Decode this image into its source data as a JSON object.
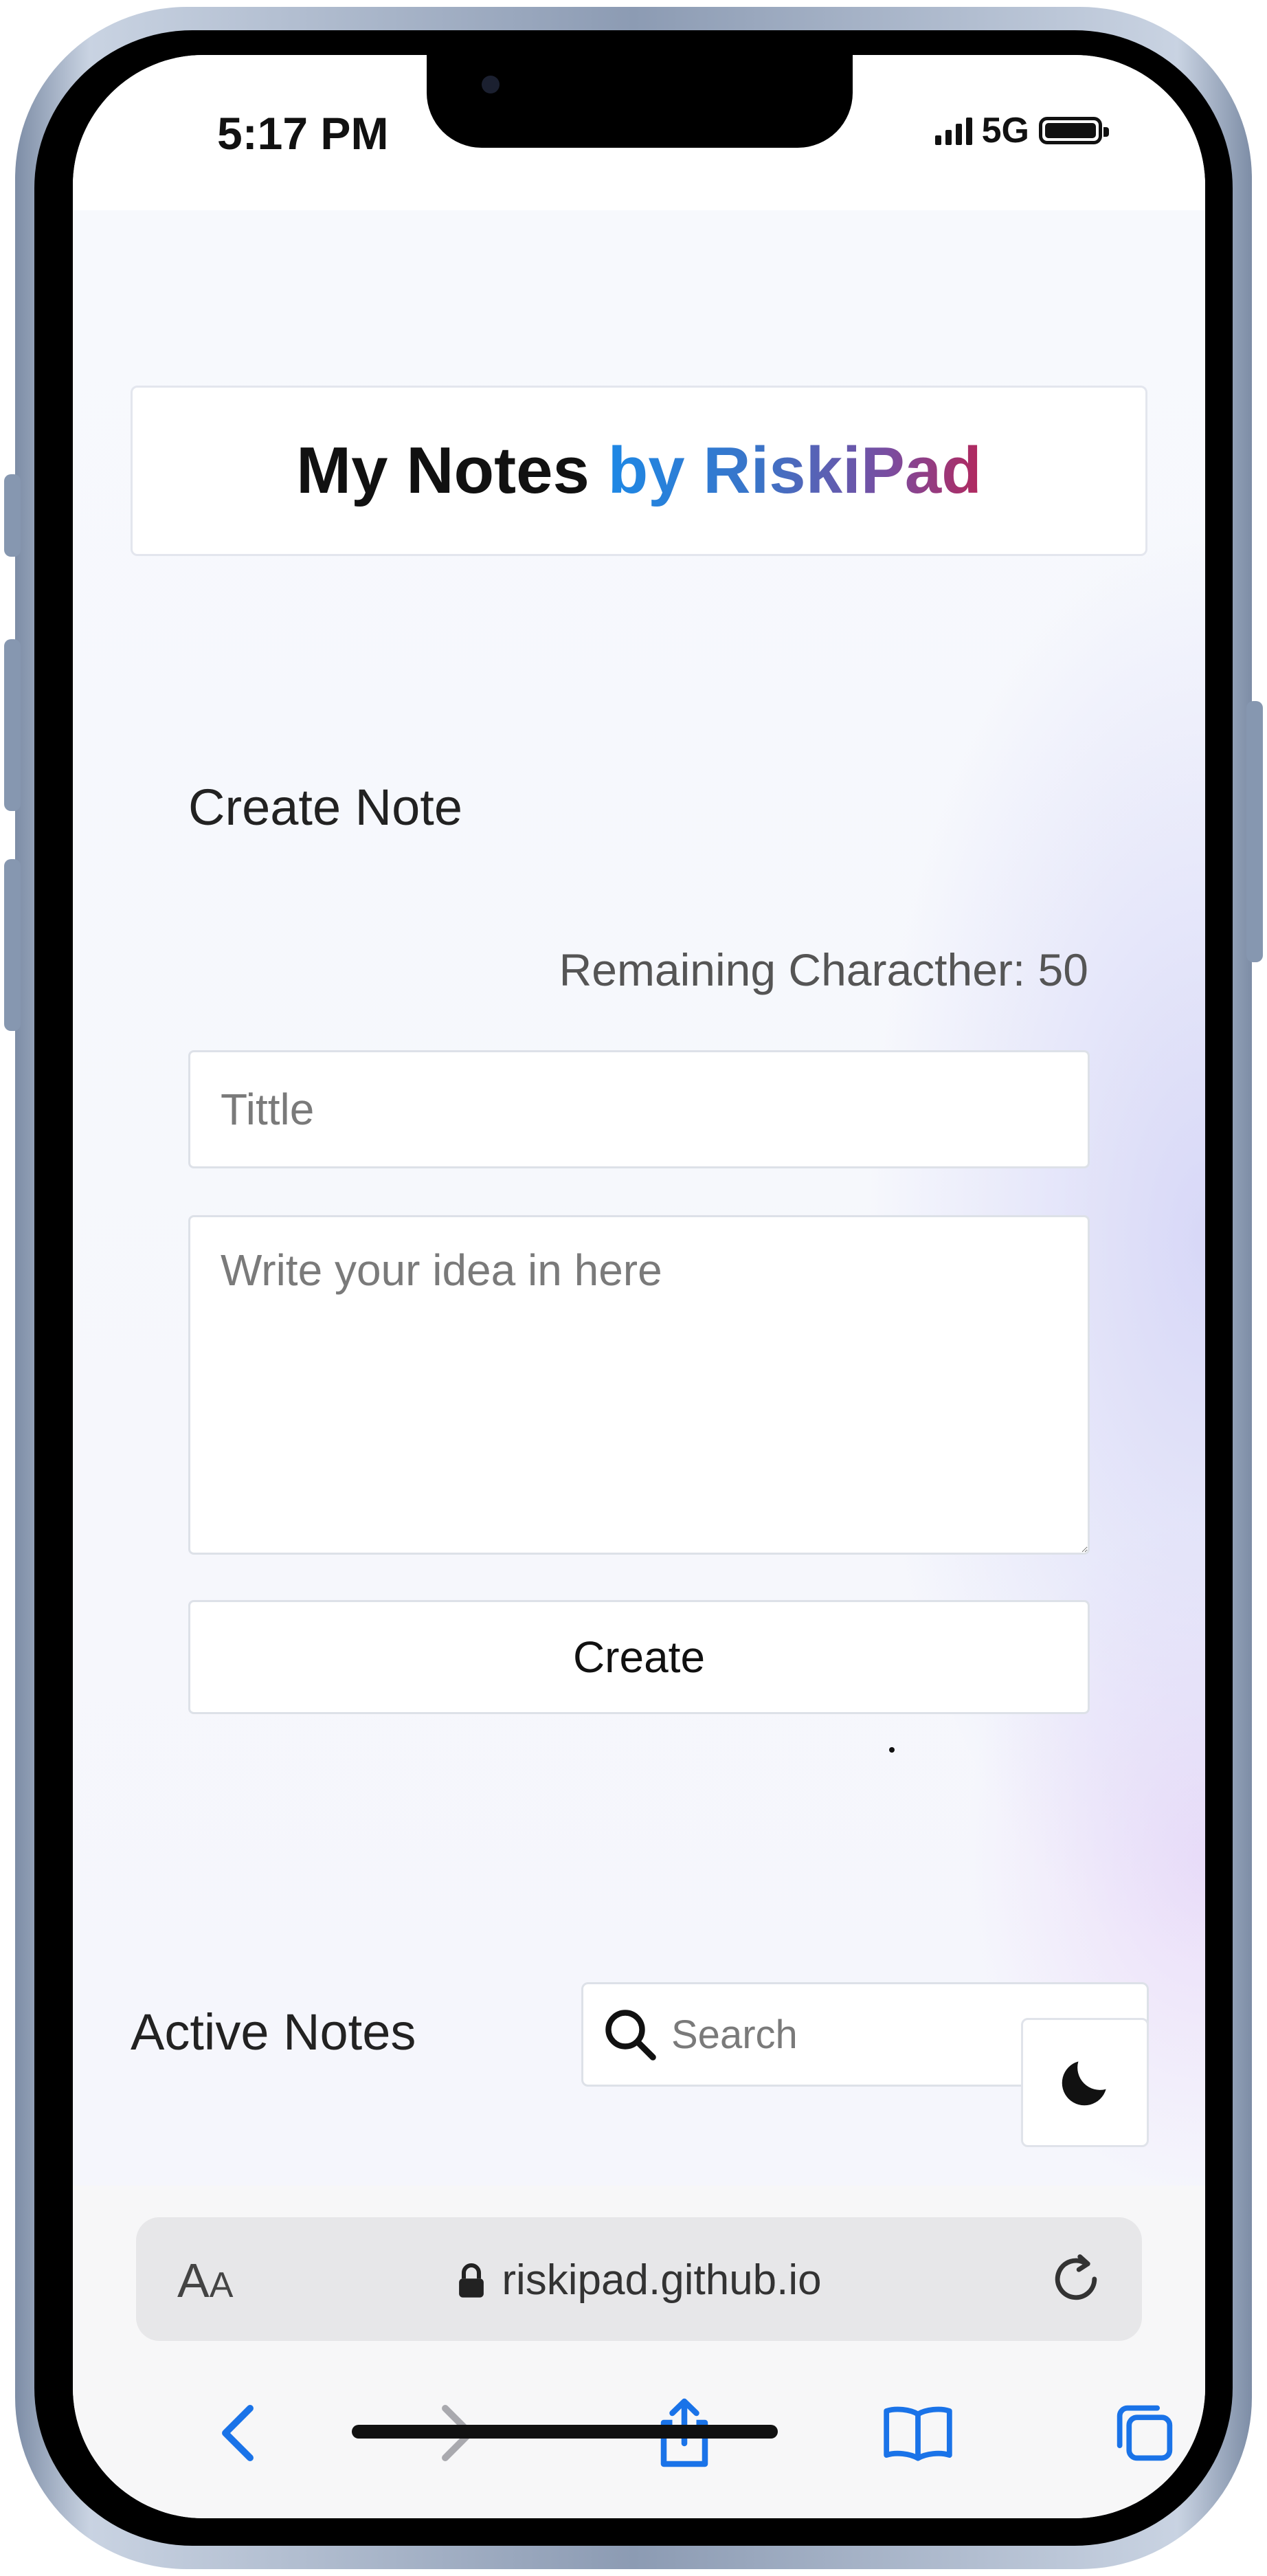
{
  "status_bar": {
    "time": "5:17 PM",
    "network": "5G",
    "icons": [
      "signal-icon",
      "battery-icon"
    ]
  },
  "header": {
    "title_prefix": "My Notes",
    "title_brand": "by RiskiPad",
    "brand_gradient": [
      "#1e88e5",
      "#3a74c8",
      "#7a4da0",
      "#b2285d"
    ]
  },
  "create_note": {
    "heading": "Create Note",
    "remaining_label": "Remaining Characther: 50",
    "title_placeholder": "Tittle",
    "body_placeholder": "Write your idea in here",
    "create_label": "Create"
  },
  "active_notes": {
    "heading": "Active Notes",
    "search_placeholder": "Search",
    "theme_toggle_icon": "moon-icon"
  },
  "browser": {
    "text_size_label": "AA",
    "url": "riskipad.github.io",
    "accent_color": "#1a73e8",
    "nav_icons": [
      "back-icon",
      "forward-icon",
      "share-icon",
      "bookmarks-icon",
      "tabs-icon"
    ]
  }
}
